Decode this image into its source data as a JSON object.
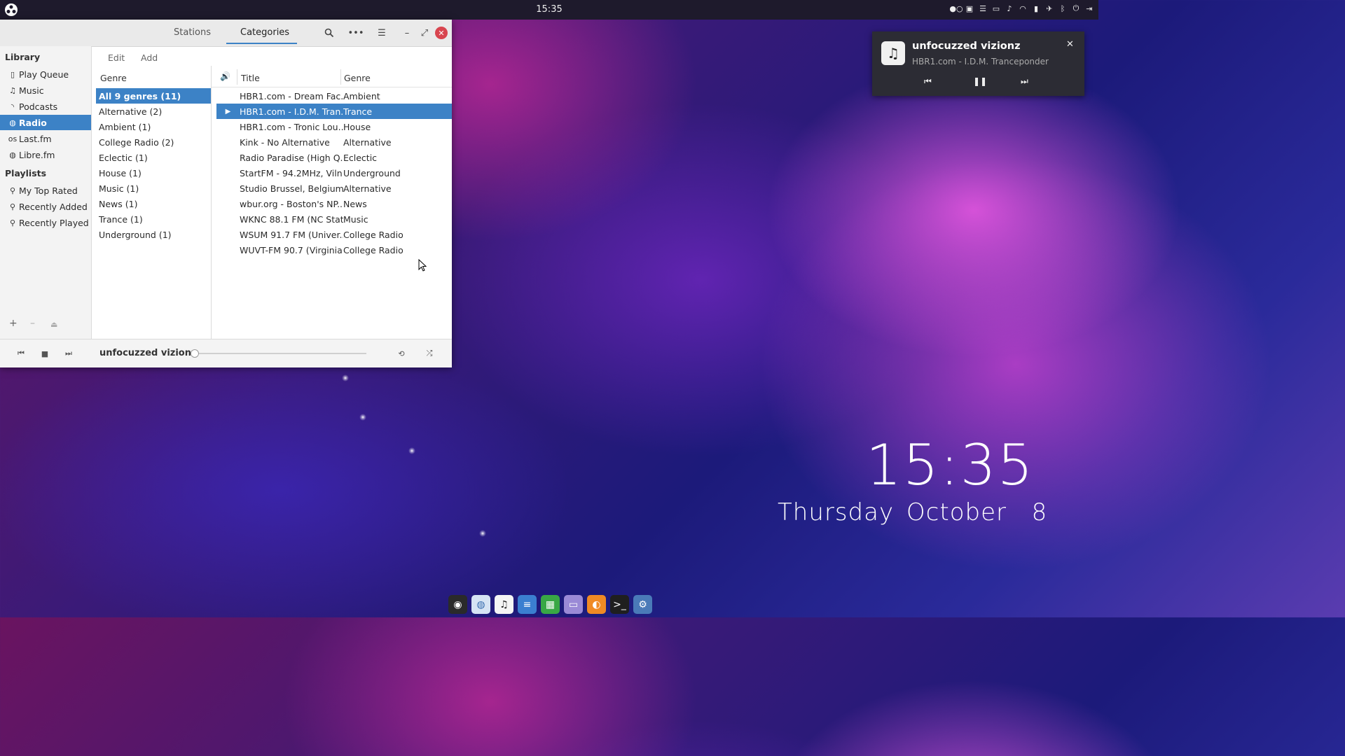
{
  "topbar": {
    "clock": "15:35"
  },
  "window": {
    "tabs": [
      "Stations",
      "Categories"
    ],
    "toolbar": {
      "edit": "Edit",
      "add": "Add"
    },
    "sidebar": {
      "library_header": "Library",
      "library": [
        {
          "label": "Play Queue",
          "icon": "document-icon"
        },
        {
          "label": "Music",
          "icon": "music-note-icon"
        },
        {
          "label": "Podcasts",
          "icon": "rss-icon"
        },
        {
          "label": "Radio",
          "icon": "globe-icon"
        },
        {
          "label": "Last.fm",
          "icon": "lastfm-icon"
        },
        {
          "label": "Libre.fm",
          "icon": "globe-icon"
        }
      ],
      "playlists_header": "Playlists",
      "playlists": [
        {
          "label": "My Top Rated",
          "icon": "search-icon"
        },
        {
          "label": "Recently Added",
          "icon": "search-icon"
        },
        {
          "label": "Recently Played",
          "icon": "search-icon"
        }
      ]
    },
    "genre_pane": {
      "header": "Genre",
      "items": [
        "All 9 genres (11)",
        "Alternative (2)",
        "Ambient (1)",
        "College Radio (2)",
        "Eclectic (1)",
        "House (1)",
        "Music (1)",
        "News (1)",
        "Trance (1)",
        "Underground (1)"
      ]
    },
    "tracks": {
      "headers": {
        "title": "Title",
        "genre": "Genre"
      },
      "rows": [
        {
          "title": "HBR1.com - Dream Fac...",
          "genre": "Ambient"
        },
        {
          "title": "HBR1.com - I.D.M. Tran...",
          "genre": "Trance"
        },
        {
          "title": "HBR1.com - Tronic Lou...",
          "genre": "House"
        },
        {
          "title": "Kink - No Alternative",
          "genre": "Alternative"
        },
        {
          "title": "Radio Paradise (High Q...",
          "genre": "Eclectic"
        },
        {
          "title": "StartFM - 94.2MHz, Viln...",
          "genre": "Underground"
        },
        {
          "title": "Studio Brussel, Belgium",
          "genre": "Alternative"
        },
        {
          "title": "wbur.org - Boston's NP...",
          "genre": "News"
        },
        {
          "title": "WKNC 88.1 FM (NC Stat...",
          "genre": "Music"
        },
        {
          "title": "WSUM 91.7 FM (Univer...",
          "genre": "College Radio"
        },
        {
          "title": "WUVT-FM 90.7 (Virginia...",
          "genre": "College Radio"
        }
      ]
    },
    "player": {
      "now_playing": "unfocuzzed vizionz",
      "progress": 0
    }
  },
  "notification": {
    "title": "unfocuzzed vizionz",
    "subtitle": "HBR1.com - I.D.M. Tranceponder"
  },
  "desktop": {
    "time": "15:35",
    "date": "Thursday October  8"
  },
  "colors": {
    "accent": "#3c82c6",
    "close": "#d8454f"
  }
}
